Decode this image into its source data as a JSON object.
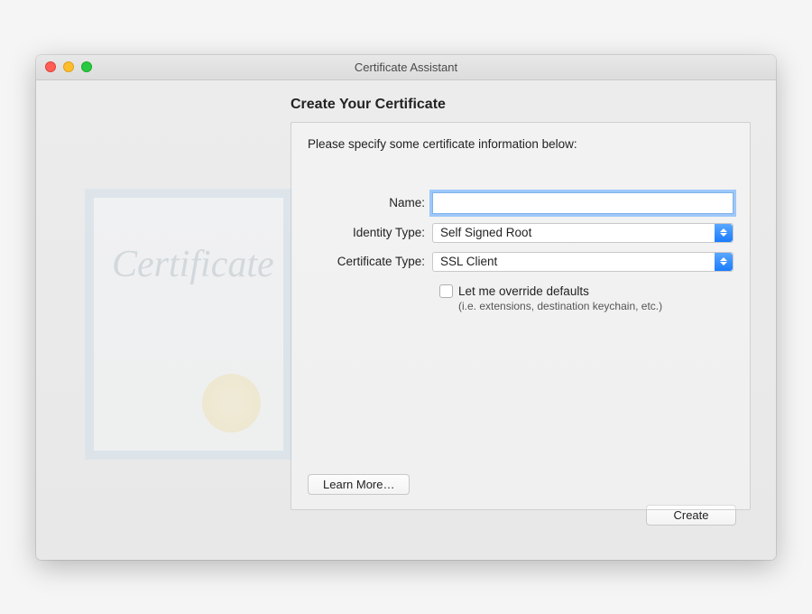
{
  "window": {
    "title": "Certificate Assistant"
  },
  "header": {
    "heading": "Create Your Certificate"
  },
  "panel": {
    "instruction": "Please specify some certificate information below:",
    "fields": {
      "name_label": "Name:",
      "name_value": "",
      "identity_label": "Identity Type:",
      "identity_value": "Self Signed Root",
      "cert_label": "Certificate Type:",
      "cert_value": "SSL Client"
    },
    "override": {
      "label": "Let me override defaults",
      "sublabel": "(i.e. extensions, destination keychain, etc.)"
    },
    "learn_more_label": "Learn More…"
  },
  "footer": {
    "create_label": "Create"
  },
  "decorative": {
    "cert_word": "Certificate"
  }
}
